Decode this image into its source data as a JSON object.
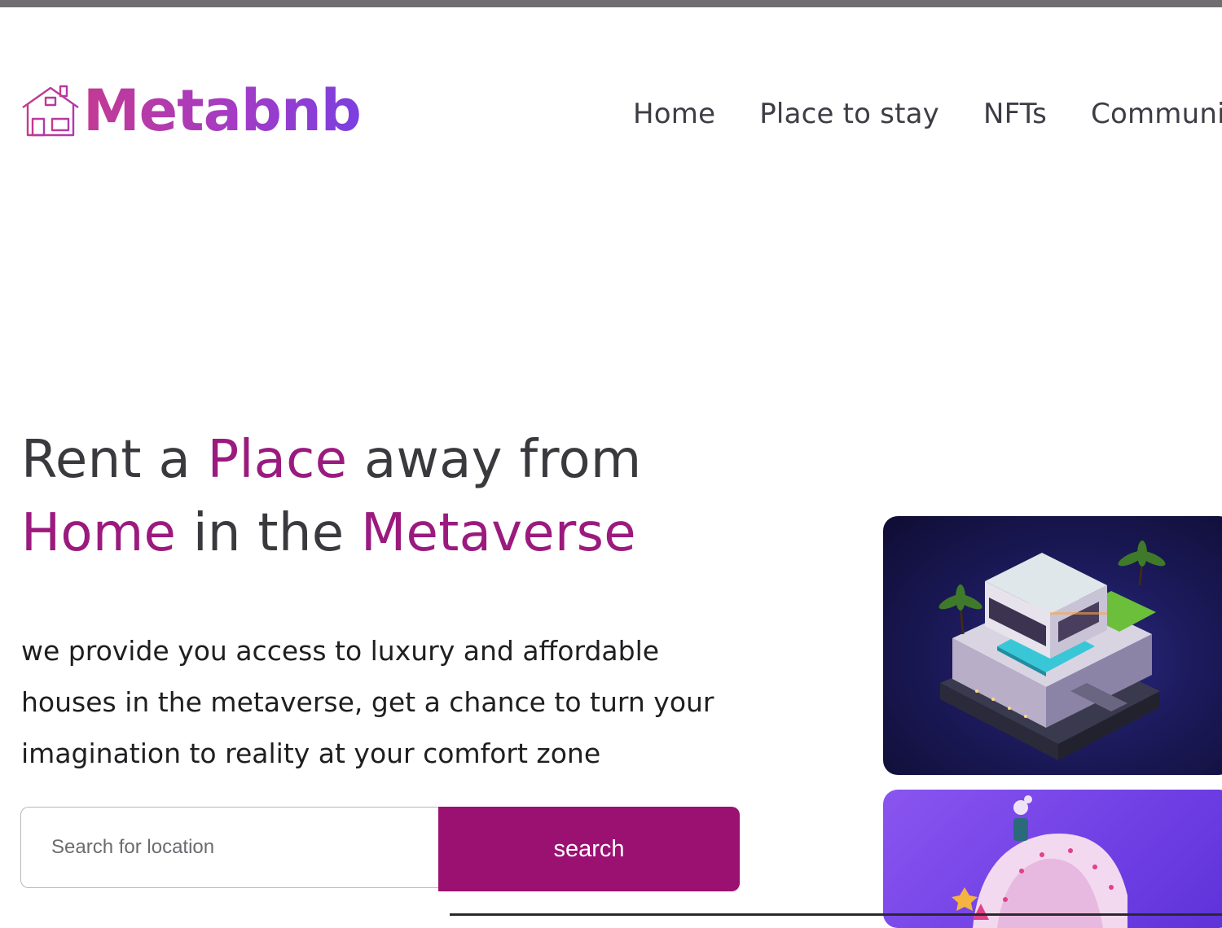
{
  "brand": {
    "name": "Metabnb",
    "logo_icon": "house-icon",
    "gradient": [
      "#c33a93",
      "#a43bc6",
      "#7b3fe0"
    ]
  },
  "nav": {
    "items": [
      {
        "label": "Home"
      },
      {
        "label": "Place to stay"
      },
      {
        "label": "NFTs"
      },
      {
        "label": "Community"
      }
    ]
  },
  "hero": {
    "headline": {
      "part1": "Rent a ",
      "accent1": "Place",
      "part2": " away from",
      "accent2": "Home",
      "part3": " in the ",
      "accent3": "Metaverse"
    },
    "description": "we provide you access to luxury and affordable houses in the metaverse, get a chance to turn your imagination to reality at your comfort zone",
    "accent_color": "#9b1a7e"
  },
  "search": {
    "placeholder": "Search for location",
    "button_label": "search",
    "button_color": "#9b1172"
  },
  "cards": [
    {
      "image": "isometric-villa-with-pool-image"
    },
    {
      "image": "pink-candy-house-image"
    }
  ]
}
